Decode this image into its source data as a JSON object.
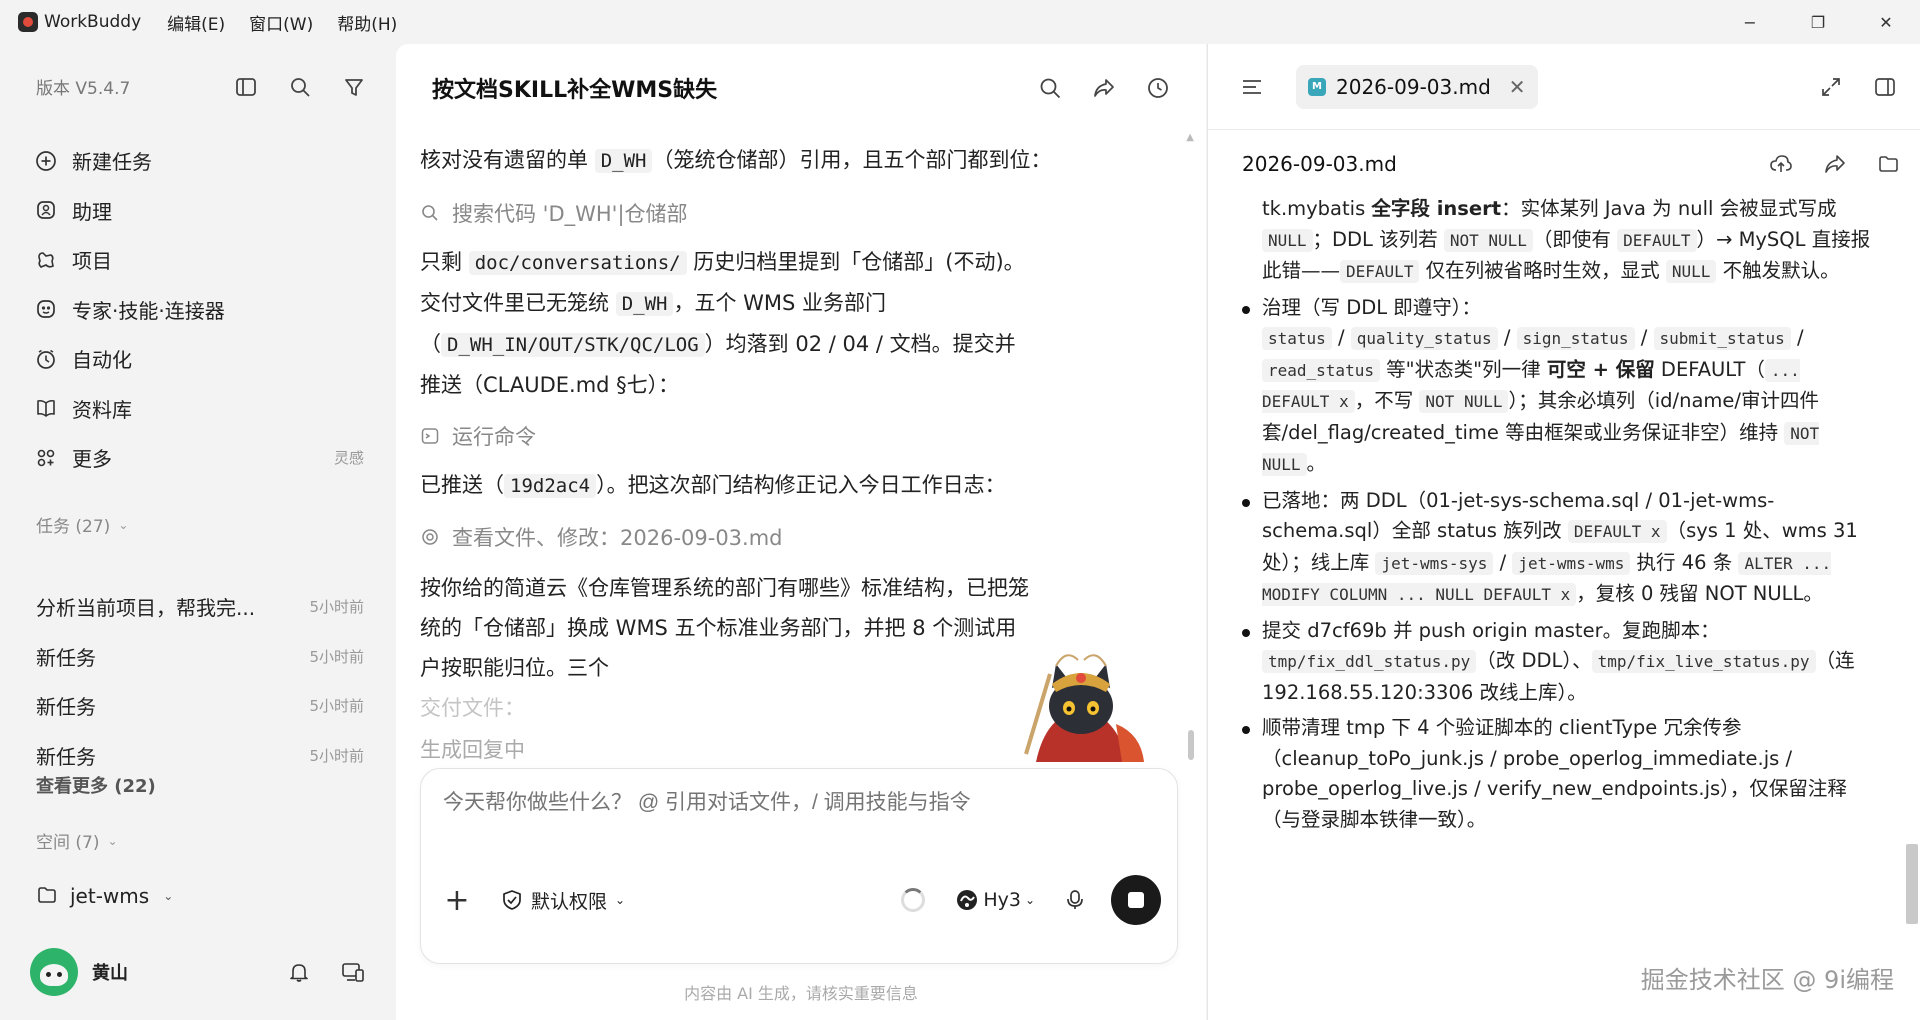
{
  "titlebar": {
    "app_name": "WorkBuddy",
    "menus": [
      "编辑(E)",
      "窗口(W)",
      "帮助(H)"
    ],
    "minimize": "−",
    "restore": "❐",
    "close": "✕"
  },
  "sidebar": {
    "version": "版本 V5.4.7",
    "nav": [
      {
        "label": "新建任务",
        "icon": "plus-circle-icon"
      },
      {
        "label": "助理",
        "icon": "assistant-icon"
      },
      {
        "label": "项目",
        "icon": "project-icon"
      },
      {
        "label": "专家·技能·连接器",
        "icon": "expert-icon"
      },
      {
        "label": "自动化",
        "icon": "clock-icon"
      },
      {
        "label": "资料库",
        "icon": "book-icon"
      },
      {
        "label": "更多",
        "icon": "apps-icon",
        "hint": "灵感"
      }
    ],
    "tasks_header": "任务 (27)",
    "tasks": [
      {
        "title": "分析当前项目，帮我完...",
        "time": "5小时前"
      },
      {
        "title": "新任务",
        "time": "5小时前"
      },
      {
        "title": "新任务",
        "time": "5小时前"
      },
      {
        "title": "新任务",
        "time": "5小时前"
      }
    ],
    "see_more": "查看更多 (22)",
    "space_header": "空间 (7)",
    "space_item": "jet-wms",
    "user_name": "黄山"
  },
  "chat": {
    "title": "按文档SKILL补全WMS缺失",
    "p1_a": "核对没有遗留的单 ",
    "p1_code": "D_WH",
    "p1_b": "（笼统仓储部）引用，且五个部门都到位：",
    "tool_search": "搜索代码 'D_WH'|仓储部",
    "p2_a": "只剩 ",
    "p2_code1": "doc/conversations/",
    "p2_b": " 历史归档里提到「仓储部」(不动)。交付文件里已无笼统 ",
    "p2_code2": "D_WH",
    "p2_c": "，五个 WMS 业务部门（",
    "p2_code3": "D_WH_IN/OUT/STK/QC/LOG",
    "p2_d": "）均落到 02 / 04 / 文档。提交并推送（CLAUDE.md §七）：",
    "tool_run": "运行命令",
    "p3_a": "已推送（",
    "p3_code": "19d2ac4",
    "p3_b": "）。把这次部门结构修正记入今日工作日志：",
    "tool_view": "查看文件、修改：2026-09-03.md",
    "p4": "按你给的简道云《仓库管理系统的部门有哪些》标准结构，已把笼统的「仓储部」换成 WMS 五个标准业务部门，并把 8 个测试用户按职能归位。三个",
    "p4_fade": "交付文件：",
    "generating": "生成回复中",
    "composer_placeholder": "今天帮你做些什么？ @ 引用对话文件，/ 调用技能与指令",
    "permission": "默认权限",
    "model": "Hy3",
    "disclaimer": "内容由 AI 生成，请核实重要信息"
  },
  "filepanel": {
    "tab_name": "2026-09-03.md",
    "file_name": "2026-09-03.md",
    "md_badge": "M",
    "b0_a": "tk.mybatis ",
    "b0_b": "全字段 insert",
    "b0_c": "：实体某列 Java 为 null 会被显式写成 ",
    "b0_code1": "NULL",
    "b0_d": "；DDL 该列若 ",
    "b0_code2": "NOT NULL",
    "b0_e": "（即使有 ",
    "b0_code3": "DEFAULT",
    "b0_f": "）→ MySQL 直接报此错——",
    "b0_code4": "DEFAULT",
    "b0_g": " 仅在列被省略时生效，显式 ",
    "b0_code5": "NULL",
    "b0_h": " 不触发默认。",
    "b1_a": "治理（写 DDL 即遵守）：",
    "b1_code1": "status",
    "b1_code2": "quality_status",
    "b1_code3": "sign_status",
    "b1_code4": "submit_status",
    "b1_code5": "read_status",
    "b1_b": " 等\"状态类\"列一律 ",
    "b1_c": "可空 + 保留",
    "b1_d": " DEFAULT（",
    "b1_code6": "... DEFAULT x",
    "b1_e": "，不写 ",
    "b1_code7": "NOT NULL",
    "b1_f": "）；其余必填列（id/name/审计四件套/del_flag/created_time 等由框架或业务保证非空）维持 ",
    "b1_code8": "NOT NULL",
    "b1_g": "。",
    "b2_a": "已落地：两 DDL（01-jet-sys-schema.sql / 01-jet-wms-schema.sql）全部 status 族列改 ",
    "b2_code1": "DEFAULT x",
    "b2_b": "（sys 1 处、wms 31 处）；线上库 ",
    "b2_code2": "jet-wms-sys",
    "b2_code3": "jet-wms-wms",
    "b2_c": " 执行 46 条 ",
    "b2_code4": "ALTER ... MODIFY COLUMN ... NULL DEFAULT x",
    "b2_d": "，复核 0 残留 NOT NULL。",
    "b3_a": "提交 d7cf69b 并 push origin master。复跑脚本：",
    "b3_code1": "tmp/fix_ddl_status.py",
    "b3_b": "（改 DDL）、",
    "b3_code2": "tmp/fix_live_status.py",
    "b3_c": "（连 192.168.55.120:3306 改线上库）。",
    "b4": "顺带清理 tmp 下 4 个验证脚本的 clientType 冗余传参（cleanup_toPo_junk.js / probe_operlog_immediate.js / probe_operlog_live.js / verify_new_endpoints.js），仅保留注释（与登录脚本铁律一致）。",
    "slash": " / "
  },
  "watermark": "掘金技术社区 @ 9i编程"
}
